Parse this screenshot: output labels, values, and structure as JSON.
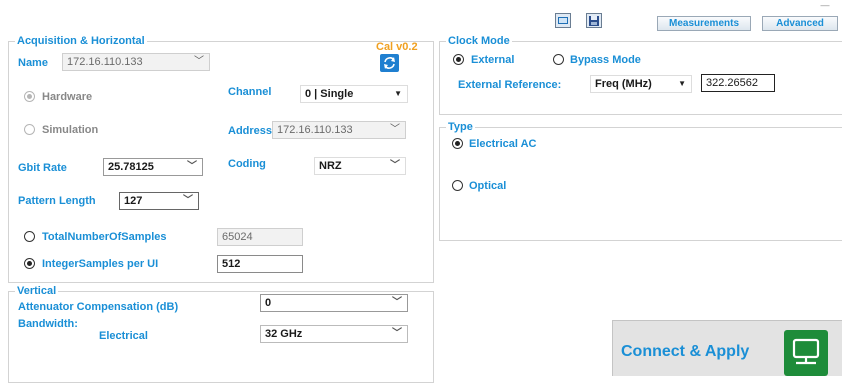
{
  "toolbar": {
    "measurements_label": "Measurements",
    "advanced_label": "Advanced",
    "window_minimize": "—"
  },
  "acq": {
    "legend": "Acquisition & Horizontal",
    "cal_label": "Cal v0.2",
    "name_label": "Name",
    "name_value": "172.16.110.133",
    "hardware_label": "Hardware",
    "simulation_label": "Simulation",
    "channel_label": "Channel",
    "channel_value": "0 | Single",
    "address_label": "Address",
    "address_value": "172.16.110.133",
    "gbit_label": "Gbit Rate",
    "gbit_value": "25.78125",
    "coding_label": "Coding",
    "coding_value": "NRZ",
    "pattern_label": "Pattern Length",
    "pattern_value": "127",
    "total_samples_label": "TotalNumberOfSamples",
    "total_samples_value": "65024",
    "integer_samples_label": "IntegerSamples per UI",
    "integer_samples_value": "512"
  },
  "vertical": {
    "legend": "Vertical",
    "atten_label": "Attenuator Compensation (dB)",
    "atten_value": "0",
    "bandwidth_label": "Bandwidth:",
    "electrical_label": "Electrical",
    "bandwidth_value": "32 GHz"
  },
  "clock": {
    "legend": "Clock Mode",
    "external_label": "External",
    "bypass_label": "Bypass Mode",
    "ext_ref_label": "External Reference:",
    "freq_value": "Freq (MHz)",
    "freq_number": "322.26562"
  },
  "type": {
    "legend": "Type",
    "electrical_ac_label": "Electrical AC",
    "optical_label": "Optical"
  },
  "connect": {
    "label": "Connect & Apply"
  },
  "colors": {
    "accent": "#1a8fd6",
    "cal": "#f0a020",
    "connect_green": "#1e8c3a"
  }
}
